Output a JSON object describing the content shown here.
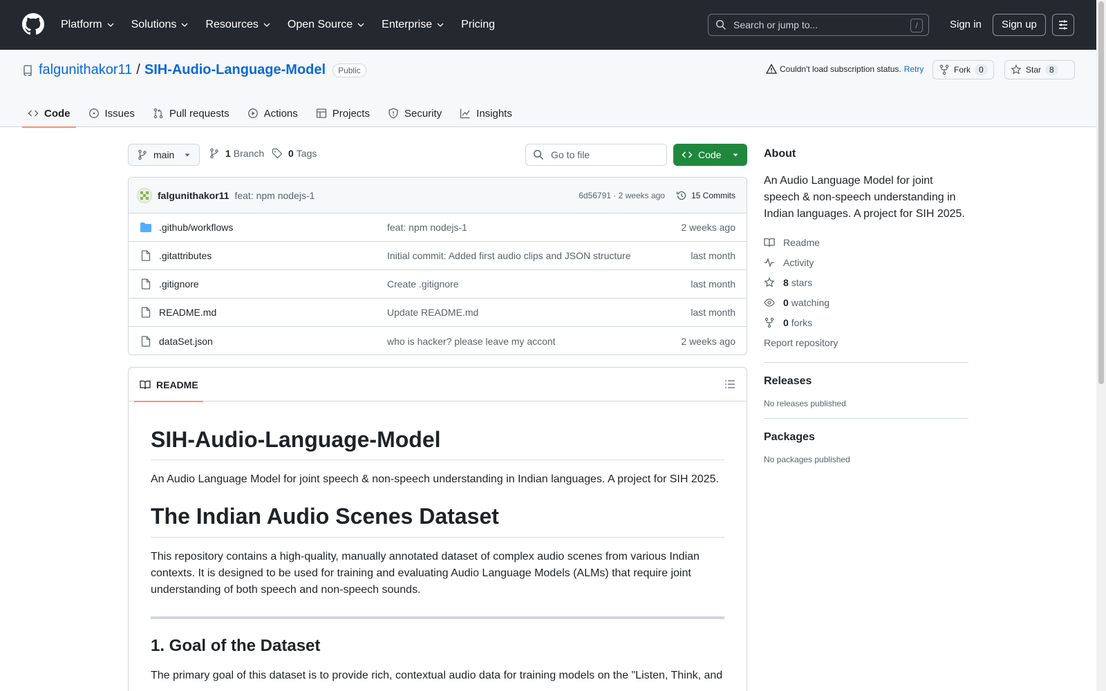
{
  "header": {
    "nav": [
      "Platform",
      "Solutions",
      "Resources",
      "Open Source",
      "Enterprise",
      "Pricing"
    ],
    "search_placeholder": "Search or jump to...",
    "search_shortcut": "/",
    "sign_in": "Sign in",
    "sign_up": "Sign up"
  },
  "repo": {
    "owner": "falgunithakor11",
    "separator": "/",
    "name": "SIH-Audio-Language-Model",
    "visibility": "Public",
    "subscription_status": "Couldn't load subscription status.",
    "retry": "Retry",
    "fork_label": "Fork",
    "fork_count": "0",
    "star_label": "Star",
    "star_count": "8"
  },
  "tabs": [
    "Code",
    "Issues",
    "Pull requests",
    "Actions",
    "Projects",
    "Security",
    "Insights"
  ],
  "branch": {
    "name": "main",
    "branch_count": "1",
    "branch_label": "Branch",
    "tag_count": "0",
    "tag_label": "Tags",
    "goto_placeholder": "Go to file",
    "code_button": "Code"
  },
  "commit": {
    "author": "falgunithakor11",
    "message": "feat: npm nodejs-1",
    "hash_age": "6d56791 · 2 weeks ago",
    "commits": "15 Commits"
  },
  "files": [
    {
      "name": ".github/workflows",
      "type": "folder",
      "message": "feat: npm nodejs-1",
      "age": "2 weeks ago"
    },
    {
      "name": ".gitattributes",
      "type": "file",
      "message": "Initial commit: Added first audio clips and JSON structure",
      "age": "last month"
    },
    {
      "name": ".gitignore",
      "type": "file",
      "message": "Create .gitignore",
      "age": "last month"
    },
    {
      "name": "README.md",
      "type": "file",
      "message": "Update README.md",
      "age": "last month"
    },
    {
      "name": "dataSet.json",
      "type": "file",
      "message": "who is hacker? please leave my accont",
      "age": "2 weeks ago"
    }
  ],
  "readme": {
    "tab": "README",
    "title": "SIH-Audio-Language-Model",
    "intro": "An Audio Language Model for joint speech & non-speech understanding in Indian languages. A project for SIH 2025.",
    "h1b": "The Indian Audio Scenes Dataset",
    "para": "This repository contains a high-quality, manually annotated dataset of complex audio scenes from various Indian contexts. It is designed to be used for training and evaluating Audio Language Models (ALMs) that require joint understanding of both speech and non-speech sounds.",
    "h2": "1. Goal of the Dataset",
    "para2": "The primary goal of this dataset is to provide rich, contextual audio data for training models on the \"Listen, Think, and"
  },
  "about": {
    "title": "About",
    "description": "An Audio Language Model for joint speech & non-speech understanding in Indian languages. A project for SIH 2025.",
    "readme": "Readme",
    "activity": "Activity",
    "stars_count": "8",
    "stars_label": "stars",
    "watching_count": "0",
    "watching_label": "watching",
    "forks_count": "0",
    "forks_label": "forks",
    "report": "Report repository"
  },
  "releases": {
    "title": "Releases",
    "empty": "No releases published"
  },
  "packages": {
    "title": "Packages",
    "empty": "No packages published"
  },
  "colors": {
    "accent": "#0969da",
    "code_button": "#1f883d",
    "header_bg": "#24292f",
    "tab_underline": "#fd8c73"
  },
  "icons": [
    "github-logo-icon",
    "chevron-down-icon",
    "search-icon",
    "menu-icon",
    "repo-icon",
    "alert-icon",
    "fork-icon",
    "star-icon",
    "code-icon",
    "issue-icon",
    "pull-request-icon",
    "play-icon",
    "table-icon",
    "shield-icon",
    "graph-icon",
    "branch-icon",
    "tag-icon",
    "history-icon",
    "folder-icon",
    "file-icon",
    "book-icon",
    "list-icon",
    "pulse-icon",
    "eye-icon"
  ]
}
